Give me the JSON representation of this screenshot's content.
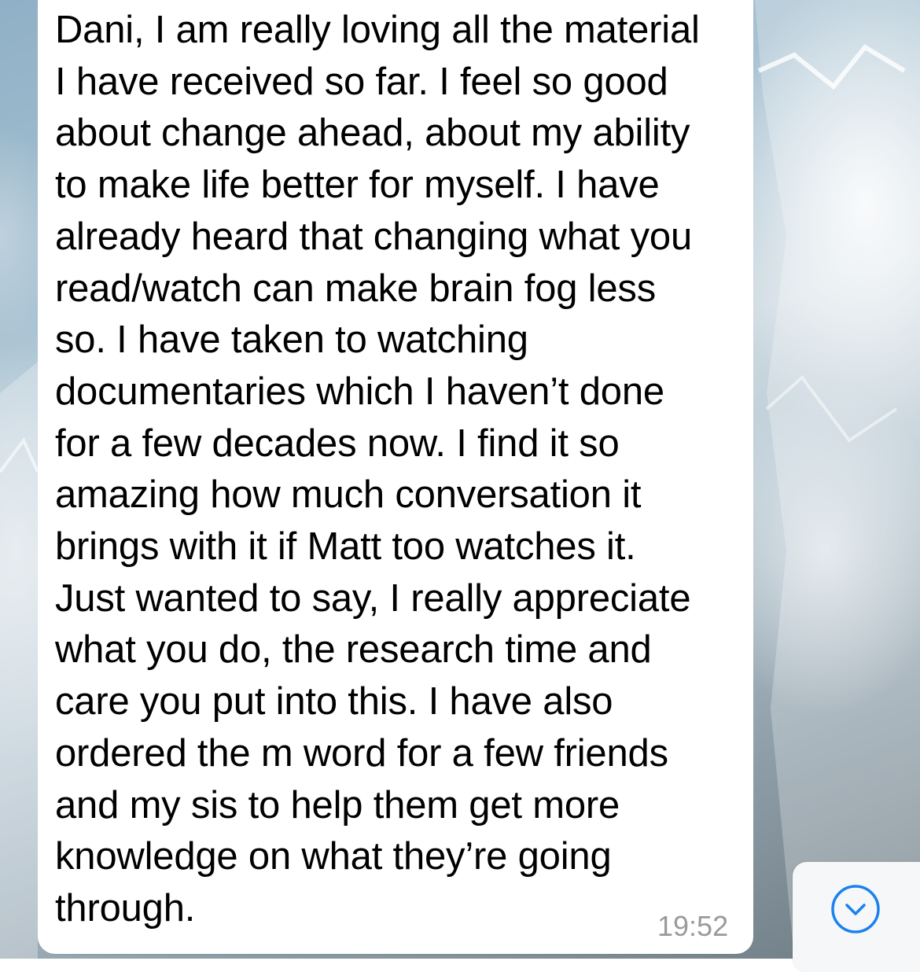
{
  "chat": {
    "message": {
      "text": "Dani, I am really loving all the material\nI have received so far. I feel so good\nabout change ahead, about my ability\nto make life better for myself. I have\nalready heard that changing what you\nread/watch can make brain fog less\nso. I have taken to watching\ndocumentaries which I haven’t done\nfor a few decades now. I find it so\namazing how much conversation it\nbrings with it if Matt too watches it.\nJust wanted to say, I really appreciate\nwhat you do, the research time and\ncare you put into this. I have also\nordered the m word for a few friends\nand my sis to help them get more\nknowledge on what they’re going\nthrough.",
      "timestamp": "19:52"
    },
    "scroll_button_icon": "chevron-down-circle-icon",
    "accent_color": "#1a82f0"
  }
}
